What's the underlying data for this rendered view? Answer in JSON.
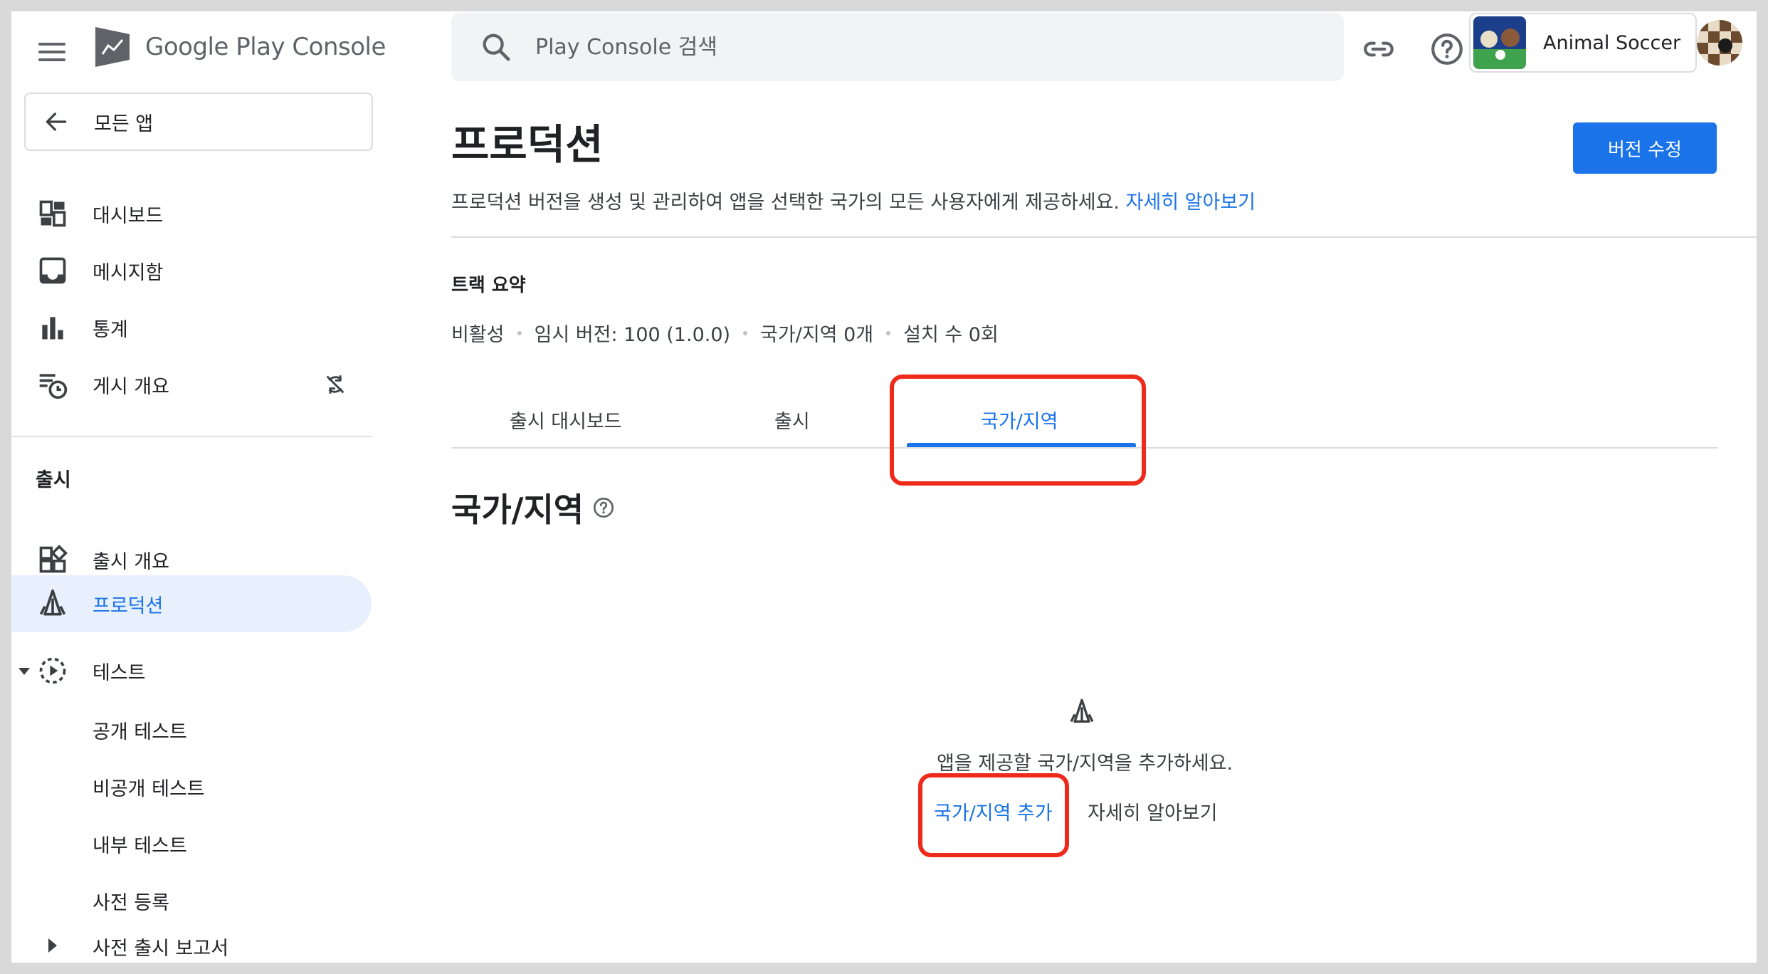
{
  "header": {
    "logo_prefix": "Google Play",
    "logo_suffix": "Console",
    "search_placeholder": "Play Console 검색",
    "app_name": "Animal Soccer"
  },
  "sidebar": {
    "back_label": "모든 앱",
    "items": [
      {
        "label": "대시보드",
        "icon": "dashboard-icon"
      },
      {
        "label": "메시지함",
        "icon": "inbox-icon"
      },
      {
        "label": "통계",
        "icon": "bar-chart-icon"
      },
      {
        "label": "게시 개요",
        "icon": "publishing-overview-icon"
      }
    ],
    "section_label": "출시",
    "release_items": [
      {
        "label": "출시 개요",
        "icon": "release-overview-icon"
      },
      {
        "label": "프로덕션",
        "icon": "production-icon",
        "active": true
      },
      {
        "label": "테스트",
        "icon": "testing-icon"
      }
    ],
    "test_subitems": [
      "공개 테스트",
      "비공개 테스트",
      "내부 테스트",
      "사전 등록"
    ],
    "prelaunch_label": "사전 출시 보고서"
  },
  "main": {
    "title": "프로덕션",
    "edit_button": "버전 수정",
    "description": "프로덕션 버전을 생성 및 관리하여 앱을 선택한 국가의 모든 사용자에게 제공하세요.",
    "learn_more": "자세히 알아보기",
    "track_summary_title": "트랙 요약",
    "track_summary": [
      "비활성",
      "임시 버전: 100 (1.0.0)",
      "국가/지역 0개",
      "설치 수 0회"
    ],
    "tabs": [
      "출시 대시보드",
      "출시",
      "국가/지역"
    ],
    "section_title": "국가/지역",
    "empty_text": "앱을 제공할 국가/지역을 추가하세요.",
    "add_button": "국가/지역 추가",
    "empty_learn_more": "자세히 알아보기"
  },
  "colors": {
    "accent": "#1a73e8",
    "highlight": "#ee2a1b"
  }
}
